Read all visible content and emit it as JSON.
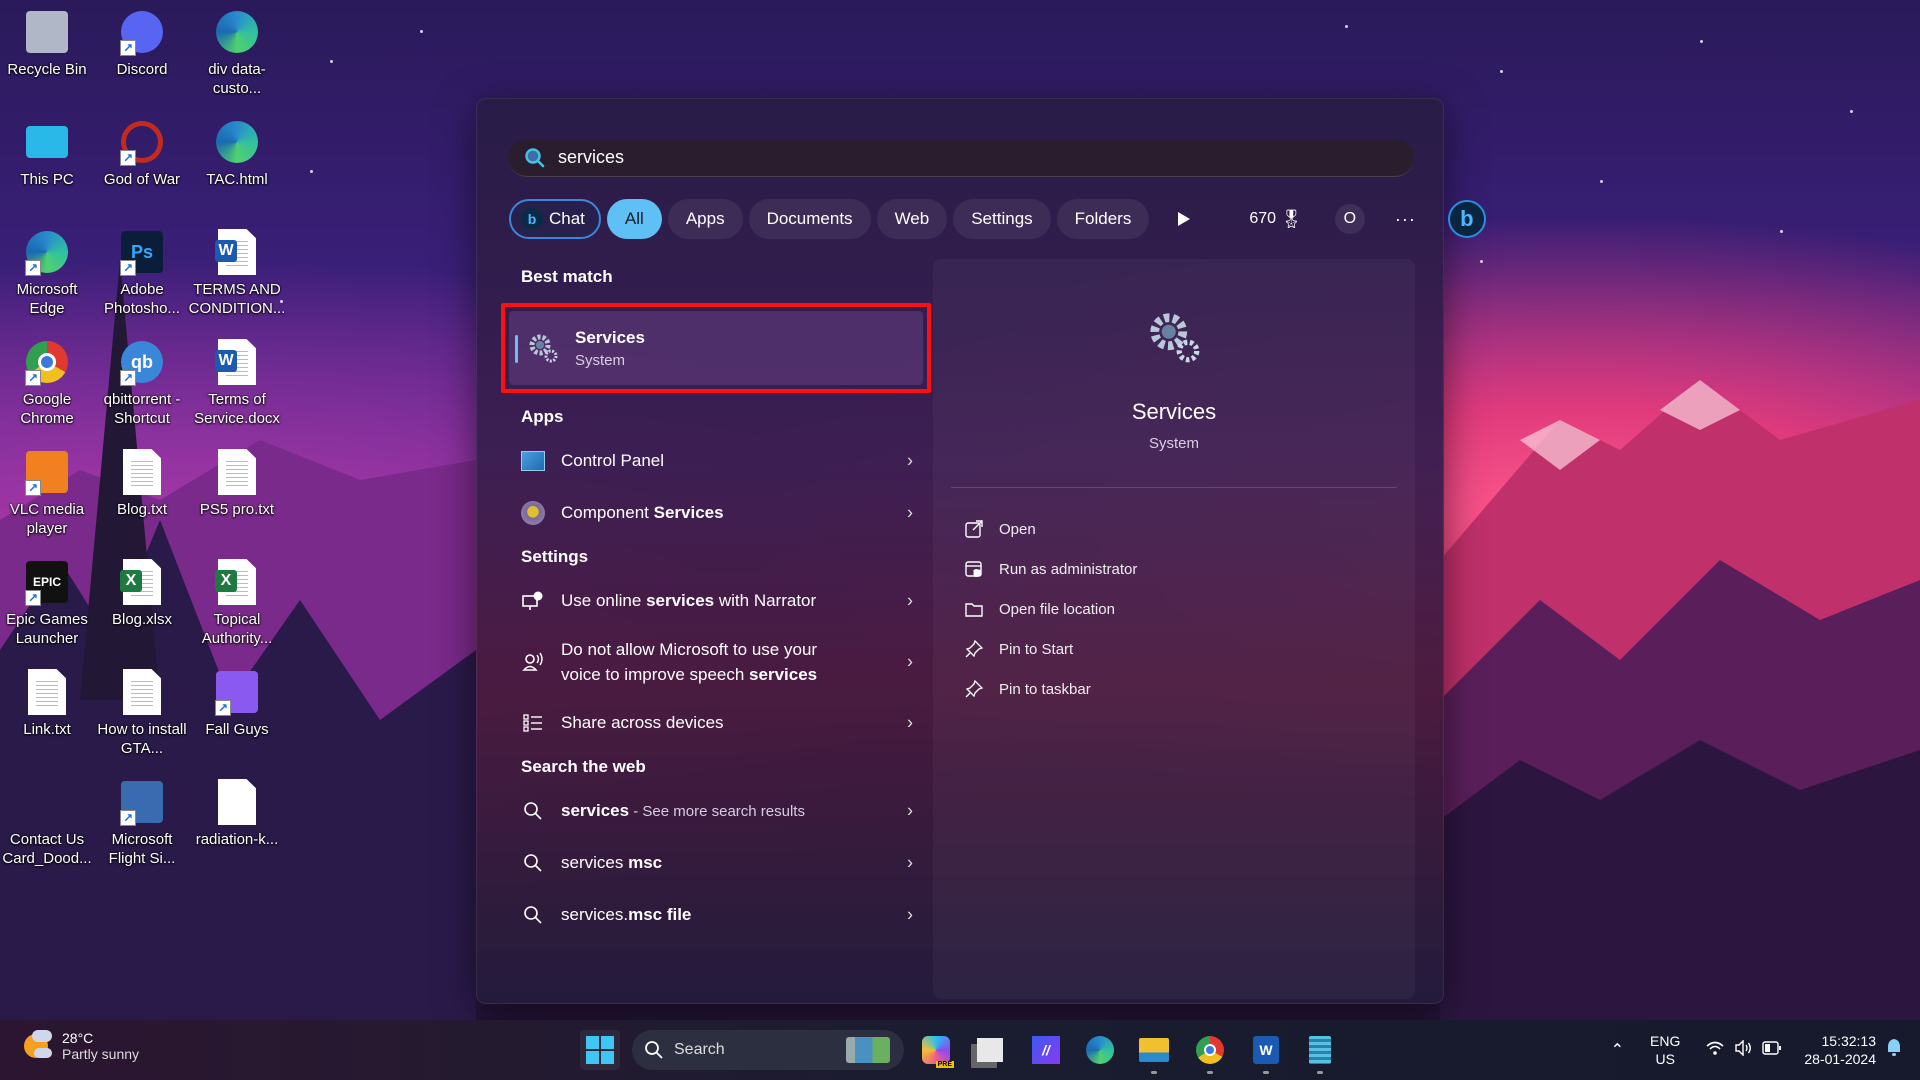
{
  "desktop": {
    "icons": [
      {
        "label": "Recycle Bin",
        "icon": "recycle-bin-icon"
      },
      {
        "label": "Discord",
        "icon": "discord-icon"
      },
      {
        "label": "div data-custo...",
        "icon": "edge-html-icon"
      },
      {
        "label": "This PC",
        "icon": "this-pc-icon"
      },
      {
        "label": "God of War",
        "icon": "god-of-war-icon"
      },
      {
        "label": "TAC.html",
        "icon": "edge-html-icon"
      },
      {
        "label": "Microsoft Edge",
        "icon": "edge-icon"
      },
      {
        "label": "Adobe Photosho...",
        "icon": "photoshop-icon"
      },
      {
        "label": "TERMS AND CONDITION...",
        "icon": "word-doc-icon"
      },
      {
        "label": "Google Chrome",
        "icon": "chrome-icon"
      },
      {
        "label": "qbittorrent - Shortcut",
        "icon": "qbittorrent-icon"
      },
      {
        "label": "Terms of Service.docx",
        "icon": "word-doc-icon"
      },
      {
        "label": "VLC media player",
        "icon": "vlc-icon"
      },
      {
        "label": "Blog.txt",
        "icon": "text-file-icon"
      },
      {
        "label": "PS5 pro.txt",
        "icon": "text-file-icon"
      },
      {
        "label": "Epic Games Launcher",
        "icon": "epic-games-icon"
      },
      {
        "label": "Blog.xlsx",
        "icon": "excel-file-icon"
      },
      {
        "label": "Topical Authority...",
        "icon": "excel-file-icon"
      },
      {
        "label": "Link.txt",
        "icon": "text-file-icon"
      },
      {
        "label": "How to install GTA...",
        "icon": "text-file-icon"
      },
      {
        "label": "Fall Guys",
        "icon": "fall-guys-icon"
      },
      {
        "label": "Contact Us Card_Dood...",
        "icon": "image-file-icon"
      },
      {
        "label": "Microsoft Flight Si...",
        "icon": "flight-sim-icon"
      },
      {
        "label": "radiation-k...",
        "icon": "blank-file-icon"
      }
    ]
  },
  "search": {
    "query": "services",
    "filters": [
      {
        "label": "Chat",
        "state": "chat"
      },
      {
        "label": "All",
        "state": "active"
      },
      {
        "label": "Apps",
        "state": ""
      },
      {
        "label": "Documents",
        "state": ""
      },
      {
        "label": "Web",
        "state": ""
      },
      {
        "label": "Settings",
        "state": ""
      },
      {
        "label": "Folders",
        "state": ""
      }
    ],
    "rewards_points": "670",
    "profile_initial": "O",
    "more_label": "···",
    "sections": {
      "best_match": "Best match",
      "apps": "Apps",
      "settings": "Settings",
      "web": "Search the web"
    },
    "best_match": {
      "title": "Services",
      "subtitle": "System",
      "highlight_color": "#ff1010"
    },
    "apps": [
      {
        "pre": "Control Panel",
        "bold": "",
        "post": ""
      },
      {
        "pre": "Component ",
        "bold": "Services",
        "post": ""
      }
    ],
    "settings": [
      {
        "pre": "Use online ",
        "bold": "services",
        "post": " with Narrator"
      },
      {
        "line1": "Do not allow Microsoft to use your",
        "line2pre": "voice to improve speech ",
        "line2bold": "services"
      },
      {
        "pre": "Share across devices",
        "bold": "",
        "post": ""
      }
    ],
    "web": [
      {
        "bold": "services",
        "suffix": " - See more search results",
        "plain": ""
      },
      {
        "plain": "services ",
        "bold": "msc",
        "suffix": ""
      },
      {
        "plain": "services.",
        "bold": "msc file",
        "suffix": ""
      }
    ],
    "preview": {
      "title": "Services",
      "subtitle": "System",
      "actions": [
        "Open",
        "Run as administrator",
        "Open file location",
        "Pin to Start",
        "Pin to taskbar"
      ]
    }
  },
  "taskbar": {
    "weather": {
      "temp": "28°C",
      "desc": "Partly sunny"
    },
    "search_placeholder": "Search",
    "language": {
      "line1": "ENG",
      "line2": "US"
    },
    "clock": {
      "time": "15:32:13",
      "date": "28-01-2024"
    }
  }
}
